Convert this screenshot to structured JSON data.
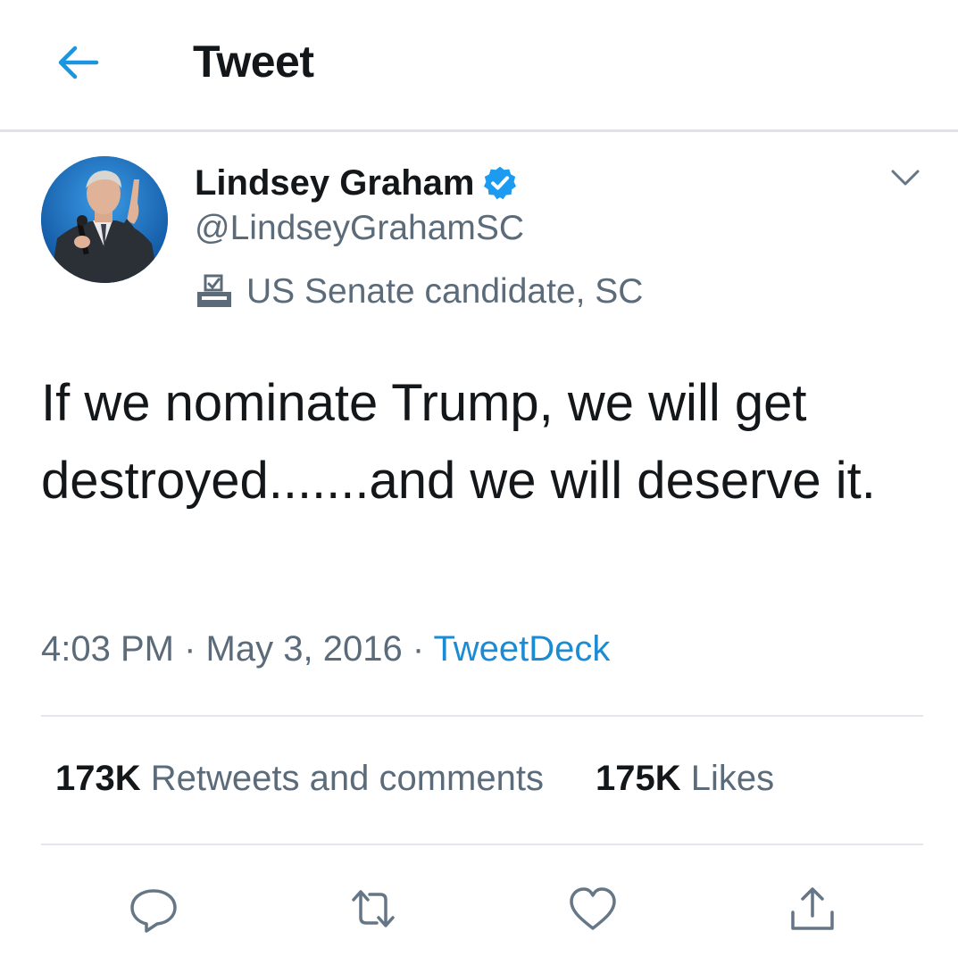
{
  "header": {
    "title": "Tweet",
    "back_icon": "back-arrow-icon"
  },
  "author": {
    "name": "Lindsey Graham",
    "handle": "@LindseyGrahamSC",
    "verified": true,
    "label": "US Senate candidate, SC",
    "label_icon": "ballot-box-icon"
  },
  "tweet": {
    "text": "If we nominate Trump, we will get destroyed.......and we will deserve it.",
    "time": "4:03 PM",
    "separator": "·",
    "date": "May 3, 2016",
    "source": "TweetDeck"
  },
  "stats": {
    "retweets_count": "173K",
    "retweets_label": "Retweets and comments",
    "likes_count": "175K",
    "likes_label": "Likes"
  },
  "actions": [
    "reply-icon",
    "retweet-icon",
    "like-icon",
    "share-icon"
  ],
  "colors": {
    "accent": "#1b8cd4",
    "text": "#14171a",
    "secondary": "#5b6b7a",
    "divider": "#e3e7eb"
  }
}
